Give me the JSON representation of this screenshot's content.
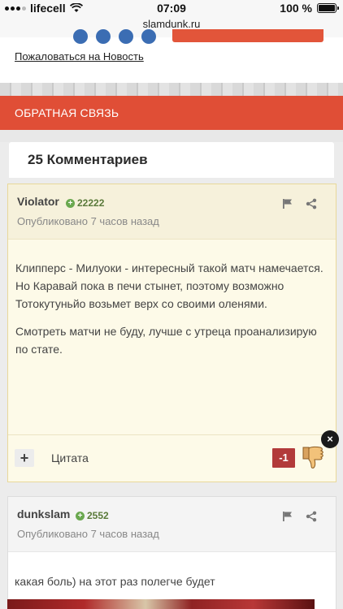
{
  "status_bar": {
    "carrier": "lifecell",
    "time": "07:09",
    "url": "slamdunk.ru",
    "battery": "100 %"
  },
  "report_link": "Пожаловаться на Новость",
  "feedback_bar": {
    "label": "ОБРАТНАЯ СВЯЗЬ"
  },
  "comments": {
    "header": "25 Комментариев",
    "items": [
      {
        "author": "Violator",
        "reputation": "22222",
        "posted": "Опубликовано 7 часов назад",
        "paragraphs": [
          "Клипперс - Милуоки - интересный такой матч намечается. Но Каравай пока в печи стынет, поэтому возможно Тотокутуньйо возьмет верх со своими оленями.",
          "Смотреть матчи не буду, лучше с утреца проанализирую по стате."
        ],
        "plus_label": "+",
        "quote_label": "Цитата",
        "score": "-1",
        "close_label": "×"
      },
      {
        "author": "dunkslam",
        "reputation": "2552",
        "posted": "Опубликовано 7 часов назад",
        "body": "какая боль) на этот раз полегче будет"
      }
    ]
  },
  "icons": {
    "flag": "flag-icon",
    "share": "share-icon",
    "reputation": "reputation-plus-icon",
    "dislike": "thumbs-down-icon",
    "wifi": "wifi-icon",
    "battery": "battery-icon"
  }
}
